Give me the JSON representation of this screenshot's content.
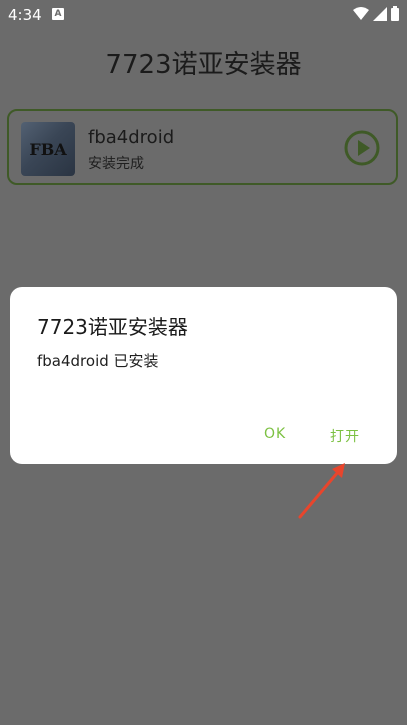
{
  "status_bar": {
    "time": "4:34",
    "notification_letter": "A"
  },
  "app": {
    "title": "7723诺亚安装器"
  },
  "app_card": {
    "icon_text": "FBA",
    "name": "fba4droid",
    "status": "安装完成"
  },
  "dialog": {
    "title": "7723诺亚安装器",
    "message": "fba4droid 已安装",
    "ok_label": "OK",
    "open_label": "打开"
  },
  "colors": {
    "scrim": "#6b6b6b",
    "accent": "#7cc142",
    "card_border": "#3f5a27",
    "annotation_arrow": "#e8452c"
  }
}
